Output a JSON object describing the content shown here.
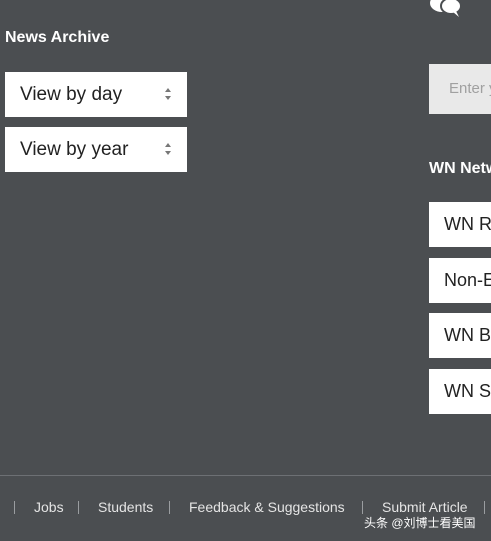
{
  "archive": {
    "title": "News Archive",
    "selects": [
      {
        "label": "View by day"
      },
      {
        "label": "View by year"
      }
    ]
  },
  "sidebar": {
    "search_placeholder": "Enter y",
    "network_title": "WN Netw",
    "network_items": [
      {
        "label": "WN R"
      },
      {
        "label": "Non-E"
      },
      {
        "label": "WN B"
      },
      {
        "label": "WN S"
      }
    ]
  },
  "footer": {
    "links": [
      "Jobs",
      "Students",
      "Feedback & Suggestions",
      "Submit Article"
    ]
  },
  "watermark": {
    "text": "头条 @刘博士看美国"
  },
  "icons": {
    "top_right": "chat-bubbles-icon",
    "select_arrows": "sort-arrows-icon"
  },
  "colors": {
    "background": "#4b4e51",
    "panel": "#ffffff",
    "search_bg": "#e9e9e9"
  }
}
